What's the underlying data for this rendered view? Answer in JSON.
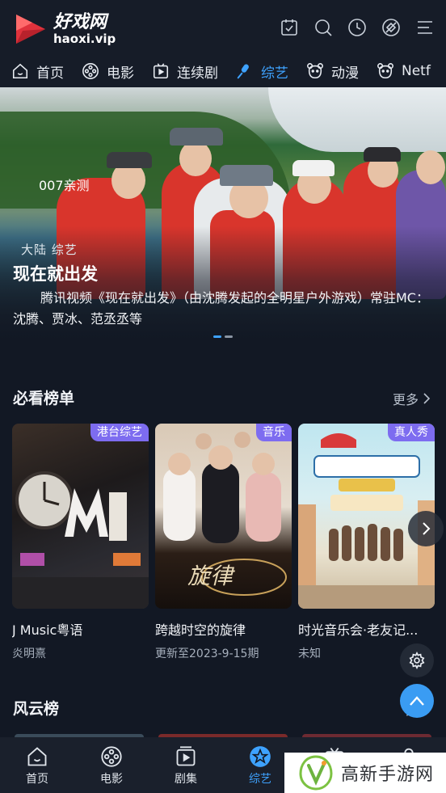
{
  "app": {
    "logo_cn": "好戏网",
    "logo_en": "haoxi.vip"
  },
  "header_icons": [
    "calendar-check-icon",
    "search-icon",
    "history-clock-icon",
    "vip-ticket-icon",
    "menu-lines-icon"
  ],
  "categories": [
    {
      "label": "首页",
      "icon": "home-icon",
      "active": false
    },
    {
      "label": "电影",
      "icon": "film-reel-icon",
      "active": false
    },
    {
      "label": "连续剧",
      "icon": "tv-play-icon",
      "active": false
    },
    {
      "label": "综艺",
      "icon": "microphone-icon",
      "active": true
    },
    {
      "label": "动漫",
      "icon": "bear-face-icon",
      "active": false
    },
    {
      "label": "Netf",
      "icon": "bear-face-icon",
      "active": false
    }
  ],
  "banner": {
    "overlay_text": "007亲测",
    "tag": "大陆 综艺",
    "title": "现在就出发",
    "description": "腾讯视频《现在就出发》（由沈腾发起的全明星户外游戏）常驻MC：沈腾、贾冰、范丞丞等",
    "dots": [
      true,
      false
    ]
  },
  "section_must_watch": {
    "title": "必看榜单",
    "more": "更多",
    "cards": [
      {
        "title": "J Music粤语",
        "sub": "炎明熹",
        "tag": "港台综艺"
      },
      {
        "title": "跨越时空的旋律",
        "sub": "更新至2023-9-15期",
        "tag": "音乐"
      },
      {
        "title": "时光音乐会·老友记...",
        "sub": "未知",
        "tag": "真人秀"
      }
    ]
  },
  "section_ranking": {
    "title": "风云榜",
    "more": "更"
  },
  "bottom_nav": [
    {
      "label": "首页",
      "icon": "home-icon",
      "active": false
    },
    {
      "label": "电影",
      "icon": "film-reel-icon",
      "active": false
    },
    {
      "label": "剧集",
      "icon": "tv-play-icon",
      "active": false
    },
    {
      "label": "综艺",
      "icon": "star-circle-icon",
      "active": true
    },
    {
      "label": "",
      "icon": "tv-play-icon",
      "active": false
    },
    {
      "label": "",
      "icon": "user-icon",
      "active": false
    }
  ],
  "watermark": {
    "text": "高新手游网"
  },
  "colors": {
    "accent": "#3ea2ff",
    "background": "#121824",
    "tag_purple": "#7d6cf0",
    "logo_red": "#e0323c"
  }
}
